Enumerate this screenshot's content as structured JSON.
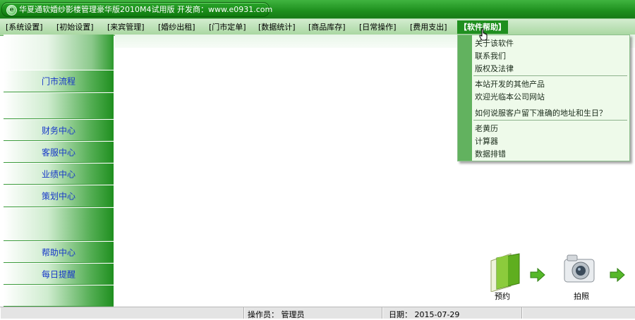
{
  "window": {
    "title": "华夏通软婚纱影楼管理豪华版2010M4试用版   开发商：www.e0931.com",
    "icon": "app-logo-icon"
  },
  "menubar": {
    "items": [
      {
        "label": "[系统设置]"
      },
      {
        "label": "[初始设置]"
      },
      {
        "label": "[来宾管理]"
      },
      {
        "label": "[婚纱出租]"
      },
      {
        "label": "[门市定单]"
      },
      {
        "label": "[数据统计]"
      },
      {
        "label": "[商品库存]"
      },
      {
        "label": "[日常操作]"
      },
      {
        "label": "[费用支出]"
      },
      {
        "label": "【软件帮助】",
        "active": true
      }
    ]
  },
  "sidebar": {
    "items": [
      {
        "label": "门市流程"
      },
      {
        "label": ""
      },
      {
        "label": "财务中心"
      },
      {
        "label": "客服中心"
      },
      {
        "label": "业绩中心"
      },
      {
        "label": "策划中心"
      },
      {
        "label": ""
      },
      {
        "label": "帮助中心"
      },
      {
        "label": "每日提醒"
      },
      {
        "label": ""
      }
    ]
  },
  "help_menu": {
    "items": [
      {
        "label": "关于该软件"
      },
      {
        "label": "联系我们"
      },
      {
        "label": "版权及法律"
      },
      {
        "label": "本站开发的其他产品"
      },
      {
        "label": "欢迎光临本公司网站"
      },
      {
        "label": "如何说服客户留下准确的地址和生日？"
      },
      {
        "label": "老黄历"
      },
      {
        "label": "计算器"
      },
      {
        "label": "数据排错"
      }
    ]
  },
  "shortcuts": {
    "sign_label": "预约",
    "sign_icon": "folder-sign-icon",
    "camera_label": "拍照",
    "camera_icon": "camera-icon",
    "arrow_icon": "green-arrow-right-icon"
  },
  "statusbar": {
    "operator": "操作员： 管理员",
    "date": "日期： 2015-07-29"
  },
  "colors": {
    "accent": "#1f8f1f",
    "menubar": "#a8d7a0",
    "link_text": "#1637c9"
  }
}
